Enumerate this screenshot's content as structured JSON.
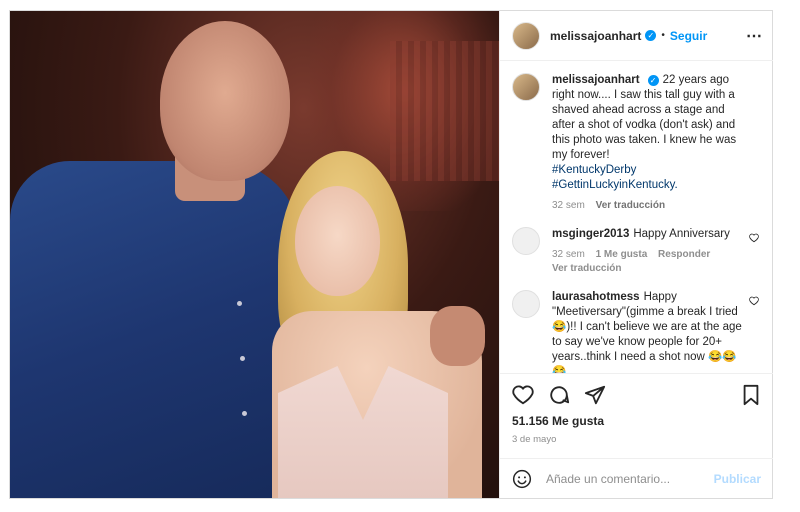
{
  "post": {
    "image_alt": "Photo of a tall man in a blue shirt with a blonde woman in a light pink dress"
  },
  "header": {
    "username": "melissajoanhart",
    "verified_glyph": "✓",
    "separator": "•",
    "follow_label": "Seguir",
    "more_icon": "⋯"
  },
  "caption": {
    "username": "melissajoanhart",
    "text": "22 years ago right now.... I saw this tall guy with a shaved ahead across a stage and after a shot of vodka (don't ask) and this photo was taken. I knew he was my forever!",
    "hashtags": [
      "#KentuckyDerby",
      "#GettinLuckyinKentucky."
    ],
    "time": "32 sem",
    "translate": "Ver traducción"
  },
  "comments": [
    {
      "username": "msginger2013",
      "text": "Happy Anniversary",
      "time": "32 sem",
      "likes": "1 Me gusta",
      "reply": "Responder",
      "translate": "Ver traducción"
    },
    {
      "username": "laurasahotmess",
      "text": "Happy \"Meetiversary\"(gimme a break I tried😂)!! I can't believe we are at the age to say we've know people for 20+ years..think I need a shot now 😂😂😂"
    }
  ],
  "stats": {
    "likes": "51.156 Me gusta",
    "date": "3 de mayo"
  },
  "add_comment": {
    "placeholder": "Añade un comentario...",
    "publish_label": "Publicar"
  },
  "icons": [
    "heart-icon",
    "comment-icon",
    "share-icon",
    "bookmark-icon",
    "emoji-icon",
    "more-icon",
    "verified-icon"
  ]
}
